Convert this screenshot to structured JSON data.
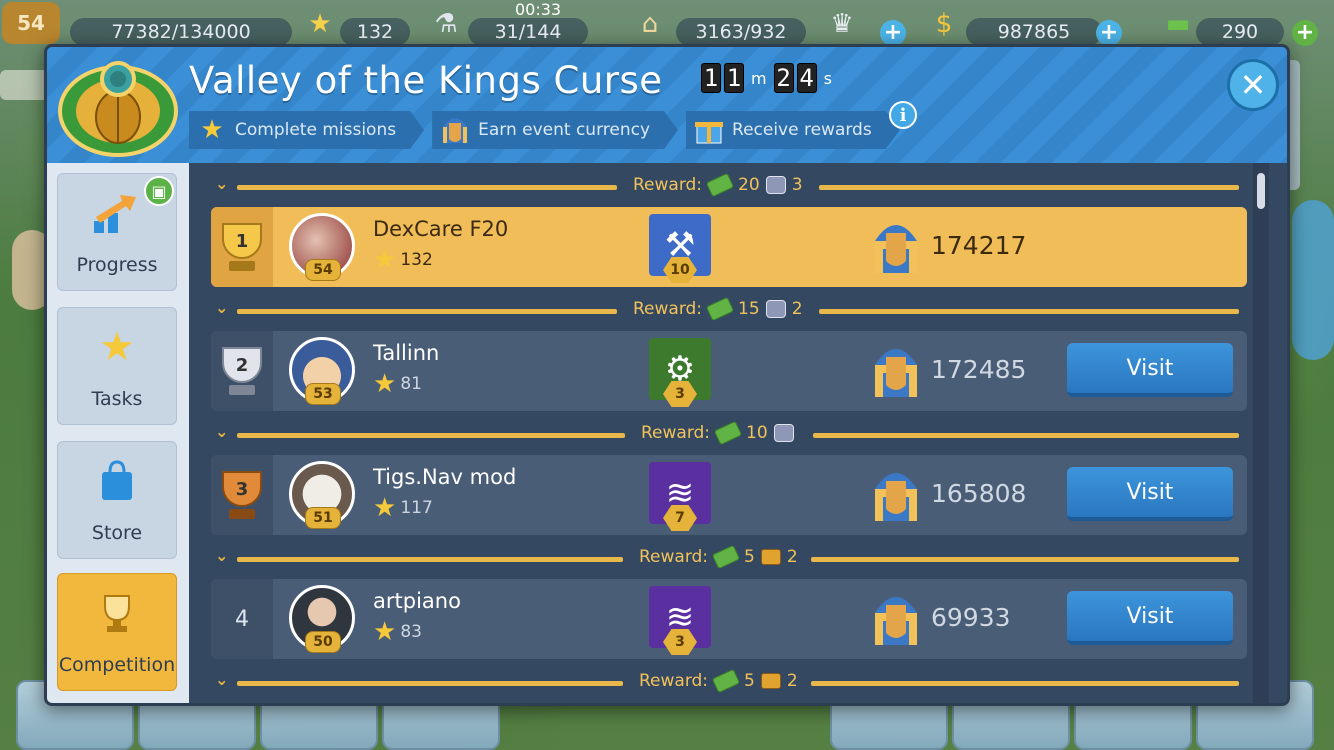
{
  "topbar": {
    "level": "54",
    "xp": "77382/134000",
    "stars": "132",
    "clock": "00:33",
    "flask": "31/144",
    "population": "3163/932",
    "coins": "987865",
    "bucks": "290"
  },
  "panel": {
    "title": "Valley of the Kings Curse",
    "timer": {
      "minutes": [
        "1",
        "1"
      ],
      "minutes_unit": "m",
      "seconds": [
        "2",
        "4"
      ],
      "seconds_unit": "s"
    },
    "steps": [
      {
        "label": "Complete missions",
        "icon": "star-icon"
      },
      {
        "label": "Earn event currency",
        "icon": "pharaoh-icon"
      },
      {
        "label": "Receive rewards",
        "icon": "gift-icon"
      }
    ],
    "close_glyph": "✕",
    "info_glyph": "i"
  },
  "sidebar": {
    "items": [
      {
        "label": "Progress",
        "icon": "progress-arrow-icon"
      },
      {
        "label": "Tasks",
        "icon": "star-icon"
      },
      {
        "label": "Store",
        "icon": "shopping-bag-icon"
      },
      {
        "label": "Competition",
        "icon": "trophy-icon"
      }
    ]
  },
  "leaderboard": {
    "reward_prefix": "Reward:",
    "rewards": [
      {
        "cash": "20",
        "cups": "3",
        "kind": "cup"
      },
      {
        "cash": "15",
        "cups": "2",
        "kind": "cup"
      },
      {
        "cash": "10",
        "cups": "",
        "kind": "cup"
      },
      {
        "cash": "5",
        "cups": "2",
        "kind": "chest"
      },
      {
        "cash": "5",
        "cups": "2",
        "kind": "chest"
      }
    ],
    "rows": [
      {
        "rank": "1",
        "name": "DexCare F20",
        "stars": "132",
        "level": "54",
        "badge_level": "10",
        "badge_icon": "hammer-icon",
        "score": "174217",
        "visit": ""
      },
      {
        "rank": "2",
        "name": "Tallinn",
        "stars": "81",
        "level": "53",
        "badge_level": "3",
        "badge_icon": "gear-icon",
        "score": "172485",
        "visit": "Visit"
      },
      {
        "rank": "3",
        "name": "Tigs.Nav mod",
        "stars": "117",
        "level": "51",
        "badge_level": "7",
        "badge_icon": "wing-icon",
        "score": "165808",
        "visit": "Visit"
      },
      {
        "rank": "4",
        "name": "artpiano",
        "stars": "83",
        "level": "50",
        "badge_level": "3",
        "badge_icon": "wing-icon",
        "score": "69933",
        "visit": "Visit"
      }
    ]
  },
  "colors": {
    "accent_gold": "#f2b83e",
    "header_blue": "#3a8fd6",
    "visit_blue": "#2a77c0"
  }
}
